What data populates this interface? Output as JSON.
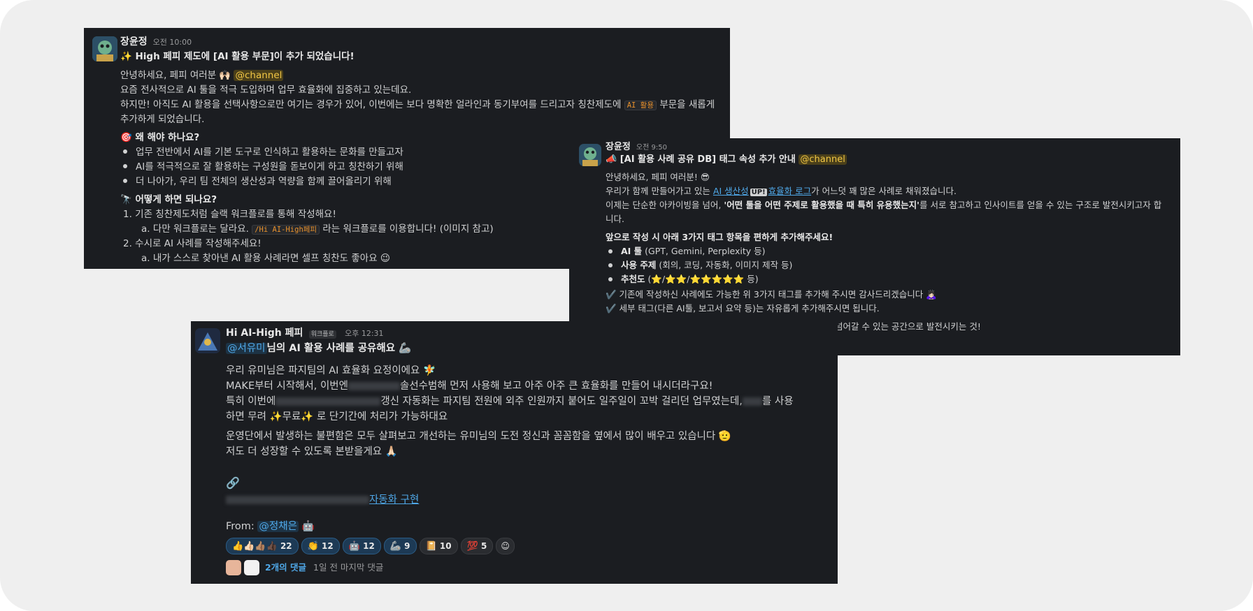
{
  "post1": {
    "author": "장윤정",
    "time": "오전 10:00",
    "title": "✨ High 페피 제도에 [AI 활용 부문]이 추가 되었습니다!",
    "greeting": "안녕하세요, 페피 여러분 🙌🏻",
    "channel_mention": "@channel",
    "line1": "요즘 전사적으로 AI 툴을 적극 도입하며 업무 효율화에 집중하고 있는데요.",
    "line2_pre": "하지만! 아직도 AI 활용을 선택사항으로만 여기는 경우가 있어, 이번에는 보다 명확한 얼라인과 동기부여를 드리고자 칭찬제도에",
    "line2_code": "AI 활용",
    "line2_post": "부문을 새롭게",
    "line3": "추가하게 되었습니다.",
    "why_heading": "🎯 왜 해야 하나요?",
    "why_items": [
      "업무 전반에서 AI를 기본 도구로 인식하고 활용하는 문화를 만들고자",
      "AI를 적극적으로 잘 활용하는 구성원을 돋보이게 하고 칭찬하기 위해",
      "더 나아가, 우리 팀 전체의 생산성과 역량을 함께 끌어올리기 위해"
    ],
    "how_heading": "🔭 어떻게 하면 되나요?",
    "how_1": "1.   기존 칭찬제도처럼 슬랙 워크플로를 통해 작성해요!",
    "how_1a_pre": "a.   다만 워크플로는 달라요.",
    "how_1a_code": "/Hi AI-High페피",
    "how_1a_post": "라는 워크플로를 이용합니다! (이미지 참고)",
    "how_2": "2.   수시로 AI 사례를 작성해주세요!",
    "how_2a": "a.   내가 스스로 찾아낸 AI 활용 사례라면 셀프 칭찬도 좋아요 😉"
  },
  "post2": {
    "author": "장윤정",
    "time": "오전 9:50",
    "title": "📣 [AI 활용 사례 공유 DB] 태그 속성 추가 안내",
    "channel_mention": "@channel",
    "greeting": "안녕하세요, 페피 여러분! 😎",
    "line1_pre": "우리가 함께 만들어가고 있는",
    "line1_link_a": "AI 생산성",
    "line1_up": "UP!",
    "line1_link_b": "효율화 로그",
    "line1_post": "가 어느덧 꽤 많은 사례로 채워졌습니다.",
    "line2_pre": "이제는 단순한 아카이빙을 넘어,",
    "line2_bold": "'어떤 툴을 어떤 주제로 활용했을 때 특히 유용했는지'",
    "line2_post": "를 서로 참고하고 인사이트를 얻을 수 있는 구조로 발전시키고자 합",
    "line3": "니다.",
    "tags_heading": "앞으로 작성 시 아래 3가지 태그 항목을 편하게 추가해주세요!",
    "tag_items": [
      {
        "bold": "AI 툴",
        "rest": " (GPT, Gemini, Perplexity 등)"
      },
      {
        "bold": "사용 주제",
        "rest": " (회의, 코딩, 자동화, 이미지 제작 등)"
      },
      {
        "bold": "추천도",
        "rest": " (⭐/⭐⭐/⭐⭐⭐⭐⭐ 등)"
      }
    ],
    "check1": "✔️ 기존에 작성하신 사례에도 가능한 위 3가지 태그를 추가해 주시면 감사드리겠습니다 🙇🏻‍♀️",
    "check2": "✔️ 세부 태그(다른 AI툴, 보고서 요약 등)는 자유롭게 추가해주시면 됩니다.",
    "last_partial": "넘어갈 수 있는 공간으로 발전시키는 것!"
  },
  "post3": {
    "author": "Hi AI-High 페피",
    "badge": "워크플로",
    "time": "오후 12:31",
    "title_mention": "@서유미",
    "title_rest": "님의 AI 활용 사례를 공유해요 🦾",
    "p1": "우리 유미님은 파지팀의 AI 효율화 요정이에요 🧚",
    "p2_pre": "MAKE부터 시작해서, 이번엔",
    "p2_post": "솔선수범해 먼저 사용해 보고 아주 아주 큰 효율화를 만들어 내시더라구요!",
    "p3_pre": "특히 이번에",
    "p3_mid": "갱신 자동화는 파지팀 전원에 외주 인원까지 붙어도 일주일이 꼬박 걸리던 업무였는데,",
    "p3_post": "를 사용",
    "p4": "하면 무려 ✨무료✨ 로 단기간에 처리가 가능하대요",
    "p5": "운영단에서 발생하는 불편함은 모두 살펴보고 개선하는 유미님의 도전 정신과 꼼꼼함을 옆에서 많이 배우고 있습니다 🫡",
    "p6": "저도 더 성장할 수 있도록 본받을게요 🙏🏻",
    "link_icon": "🔗",
    "link_text": "자동화 구현",
    "from_label": "From:",
    "from_mention": "@정채은",
    "from_emoji": "🤖",
    "reactions": [
      {
        "emoji": "👍👍🏻👍🏽👍🏿",
        "count": "22"
      },
      {
        "emoji": "👏",
        "count": "12"
      },
      {
        "emoji": "🤖",
        "count": "12"
      },
      {
        "emoji": "🦾",
        "count": "9"
      },
      {
        "emoji": "📔",
        "count": "10"
      },
      {
        "emoji": "💯",
        "count": "5"
      }
    ],
    "add_reaction_icon": "☺",
    "replies": "2개의 댓글",
    "last_reply": "1일 전 마지막 댓글"
  }
}
